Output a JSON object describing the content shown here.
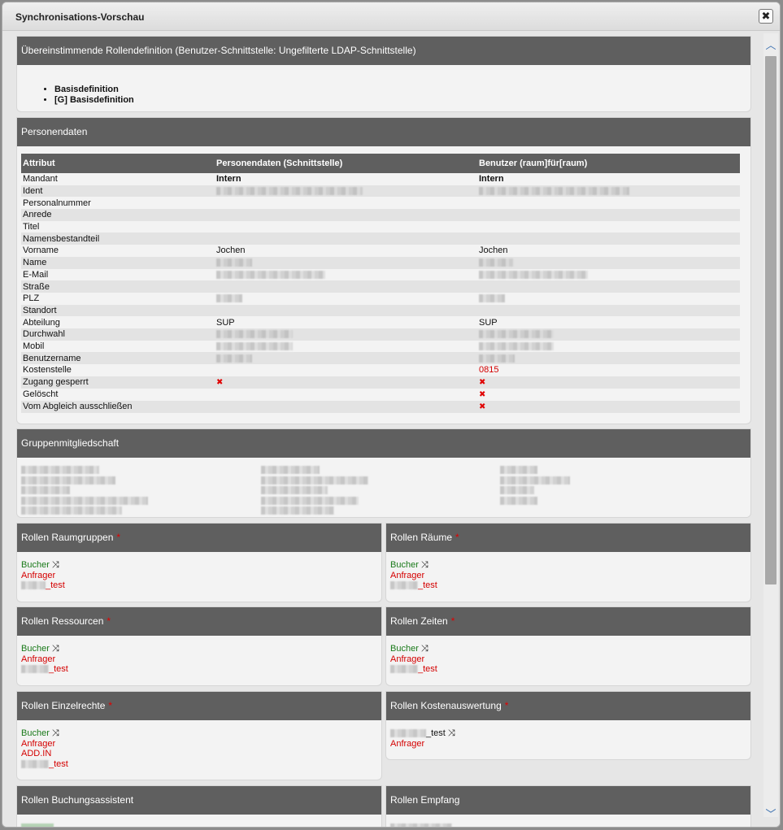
{
  "dialog": {
    "title": "Synchronisations-Vorschau",
    "close_label": "✖"
  },
  "role_definition": {
    "header": "Übereinstimmende Rollendefinition (Benutzer-Schnittstelle: Ungefilterte LDAP-Schnittstelle)",
    "items": [
      "Basisdefinition",
      "[G] Basisdefinition"
    ]
  },
  "person_data": {
    "header": "Personendaten",
    "columns": [
      "Attribut",
      "Personendaten (Schnittstelle)",
      "Benutzer (raum]für[raum)"
    ],
    "rows": [
      {
        "attr": "Mandant",
        "iface": "Intern",
        "user": "Intern",
        "bold": true
      },
      {
        "attr": "Ident",
        "iface": "",
        "user": "",
        "blur_iface": 180,
        "blur_user": 185
      },
      {
        "attr": "Personalnummer",
        "iface": "",
        "user": ""
      },
      {
        "attr": "Anrede",
        "iface": "",
        "user": ""
      },
      {
        "attr": "Titel",
        "iface": "",
        "user": ""
      },
      {
        "attr": "Namensbestandteil",
        "iface": "",
        "user": ""
      },
      {
        "attr": "Vorname",
        "iface": "Jochen",
        "user": "Jochen"
      },
      {
        "attr": "Name",
        "iface": "",
        "user": "",
        "blur_iface": 44,
        "blur_user": 42
      },
      {
        "attr": "E-Mail",
        "iface": "",
        "user": "",
        "blur_iface": 134,
        "blur_user": 134
      },
      {
        "attr": "Straße",
        "iface": "",
        "user": ""
      },
      {
        "attr": "PLZ",
        "iface": "",
        "user": "",
        "blur_iface": 32,
        "blur_user": 32
      },
      {
        "attr": "Standort",
        "iface": "",
        "user": ""
      },
      {
        "attr": "Abteilung",
        "iface": "SUP",
        "user": "SUP"
      },
      {
        "attr": "Durchwahl",
        "iface": "",
        "user": "",
        "blur_iface": 94,
        "blur_user": 92
      },
      {
        "attr": "Mobil",
        "iface": "",
        "user": "",
        "blur_iface": 94,
        "blur_user": 92
      },
      {
        "attr": "Benutzername",
        "iface": "",
        "user": "",
        "blur_iface": 44,
        "blur_user": 44
      },
      {
        "attr": "Kostenstelle",
        "iface": "",
        "user": "0815",
        "user_red": true
      },
      {
        "attr": "Zugang gesperrt",
        "iface": "✖",
        "user": "✖",
        "xmark": true
      },
      {
        "attr": "Gelöscht",
        "iface": "",
        "user": "✖",
        "xmark": true
      },
      {
        "attr": "Vom Abgleich ausschließen",
        "iface": "",
        "user": "✖",
        "xmark": true
      }
    ]
  },
  "group_membership": {
    "header": "Gruppenmitgliedschaft"
  },
  "roles": {
    "room_groups": {
      "header": "Rollen Raumgruppen",
      "req": "*",
      "bucher": "Bucher",
      "anfrager": "Anfrager",
      "test": "_test"
    },
    "rooms": {
      "header": "Rollen Räume",
      "req": "*",
      "bucher": "Bucher",
      "anfrager": "Anfrager",
      "test": "_test"
    },
    "resources": {
      "header": "Rollen Ressourcen",
      "req": "*",
      "bucher": "Bucher",
      "anfrager": "Anfrager",
      "test": "_test"
    },
    "times": {
      "header": "Rollen Zeiten",
      "req": "*",
      "bucher": "Bucher",
      "anfrager": "Anfrager",
      "test": "_test"
    },
    "single_rights": {
      "header": "Rollen Einzelrechte",
      "req": "*",
      "bucher": "Bucher",
      "anfrager": "Anfrager",
      "addin": "ADD.IN",
      "test": "_test"
    },
    "cost_eval": {
      "header": "Rollen Kostenauswertung",
      "req": "*",
      "test": "_test",
      "anfrager": "Anfrager"
    },
    "booking_assistant": {
      "header": "Rollen Buchungsassistent"
    },
    "reception": {
      "header": "Rollen Empfang"
    }
  },
  "icons": {
    "shuffle": "shuffle-icon",
    "close": "close-icon",
    "scroll_up": "chevron-up-icon",
    "scroll_down": "chevron-down-icon"
  },
  "colors": {
    "header_bg": "#5f5f5f",
    "green": "#1a7a1a",
    "red": "#d40000",
    "accent": "#3a6fb0"
  }
}
